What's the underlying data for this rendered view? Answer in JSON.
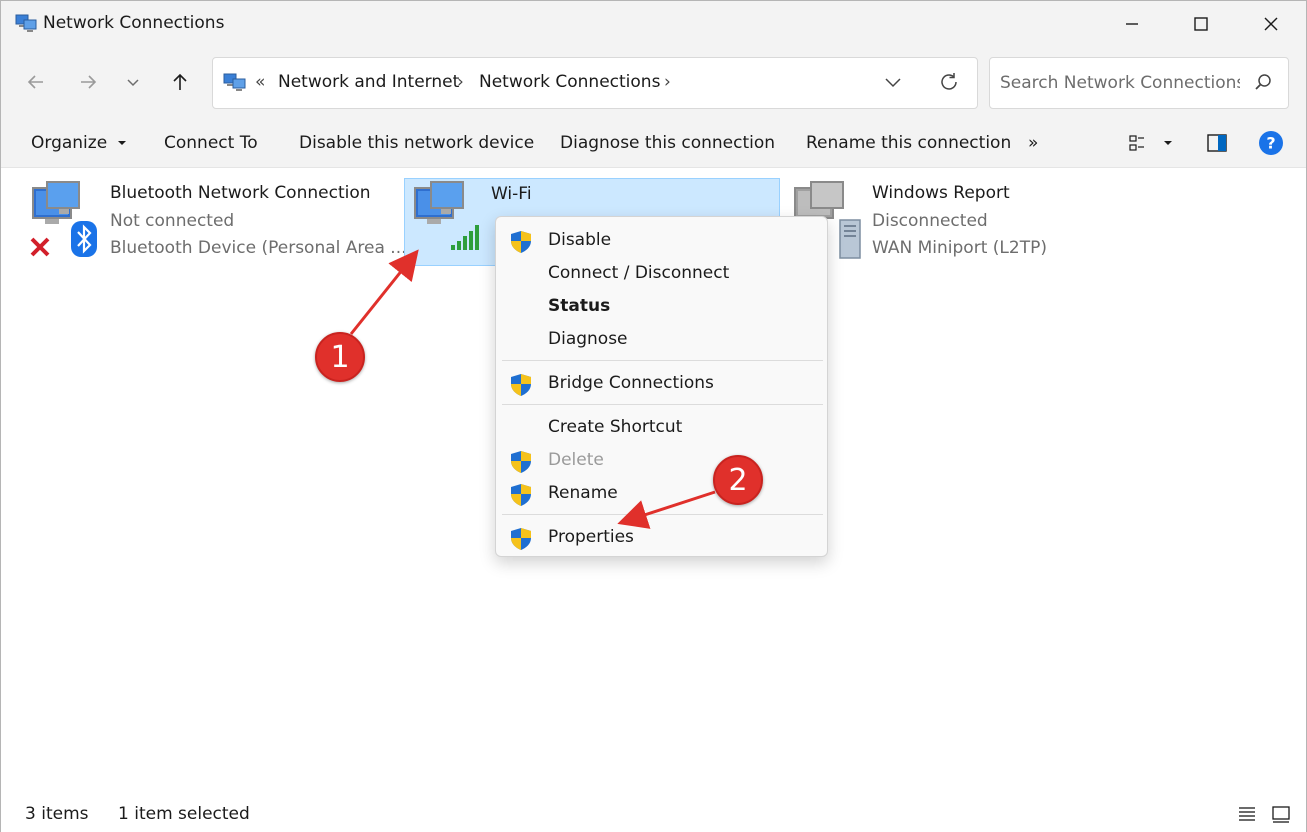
{
  "window": {
    "title": "Network Connections"
  },
  "address": {
    "overflow": "«",
    "crumbs": [
      "Network and Internet",
      "Network Connections"
    ],
    "separator": "›"
  },
  "search": {
    "placeholder": "Search Network Connections"
  },
  "commandbar": {
    "organize": "Organize",
    "connect_to": "Connect To",
    "disable_device": "Disable this network device",
    "diagnose": "Diagnose this connection",
    "rename": "Rename this connection",
    "more": "»"
  },
  "connections": [
    {
      "name": "Bluetooth Network Connection",
      "status": "Not connected",
      "device": "Bluetooth Device (Personal Area ..."
    },
    {
      "name": "Wi-Fi",
      "status": "",
      "device": ""
    },
    {
      "name": "Windows Report",
      "status": "Disconnected",
      "device": "WAN Miniport (L2TP)"
    }
  ],
  "context_menu": {
    "items": [
      {
        "label": "Disable",
        "shield": true
      },
      {
        "label": "Connect / Disconnect",
        "shield": false
      },
      {
        "label": "Status",
        "shield": false,
        "bold": true
      },
      {
        "label": "Diagnose",
        "shield": false
      },
      {
        "label": "Bridge Connections",
        "shield": true
      },
      {
        "label": "Create Shortcut",
        "shield": false
      },
      {
        "label": "Delete",
        "shield": true,
        "disabled": true
      },
      {
        "label": "Rename",
        "shield": true
      },
      {
        "label": "Properties",
        "shield": true
      }
    ]
  },
  "annotations": {
    "step1": "1",
    "step2": "2",
    "color": "#e0302b"
  },
  "statusbar": {
    "count": "3 items",
    "selected": "1 item selected"
  },
  "colors": {
    "selection_bg": "#cce8ff",
    "selection_border": "#99d1ff",
    "accent": "#0067c0"
  }
}
